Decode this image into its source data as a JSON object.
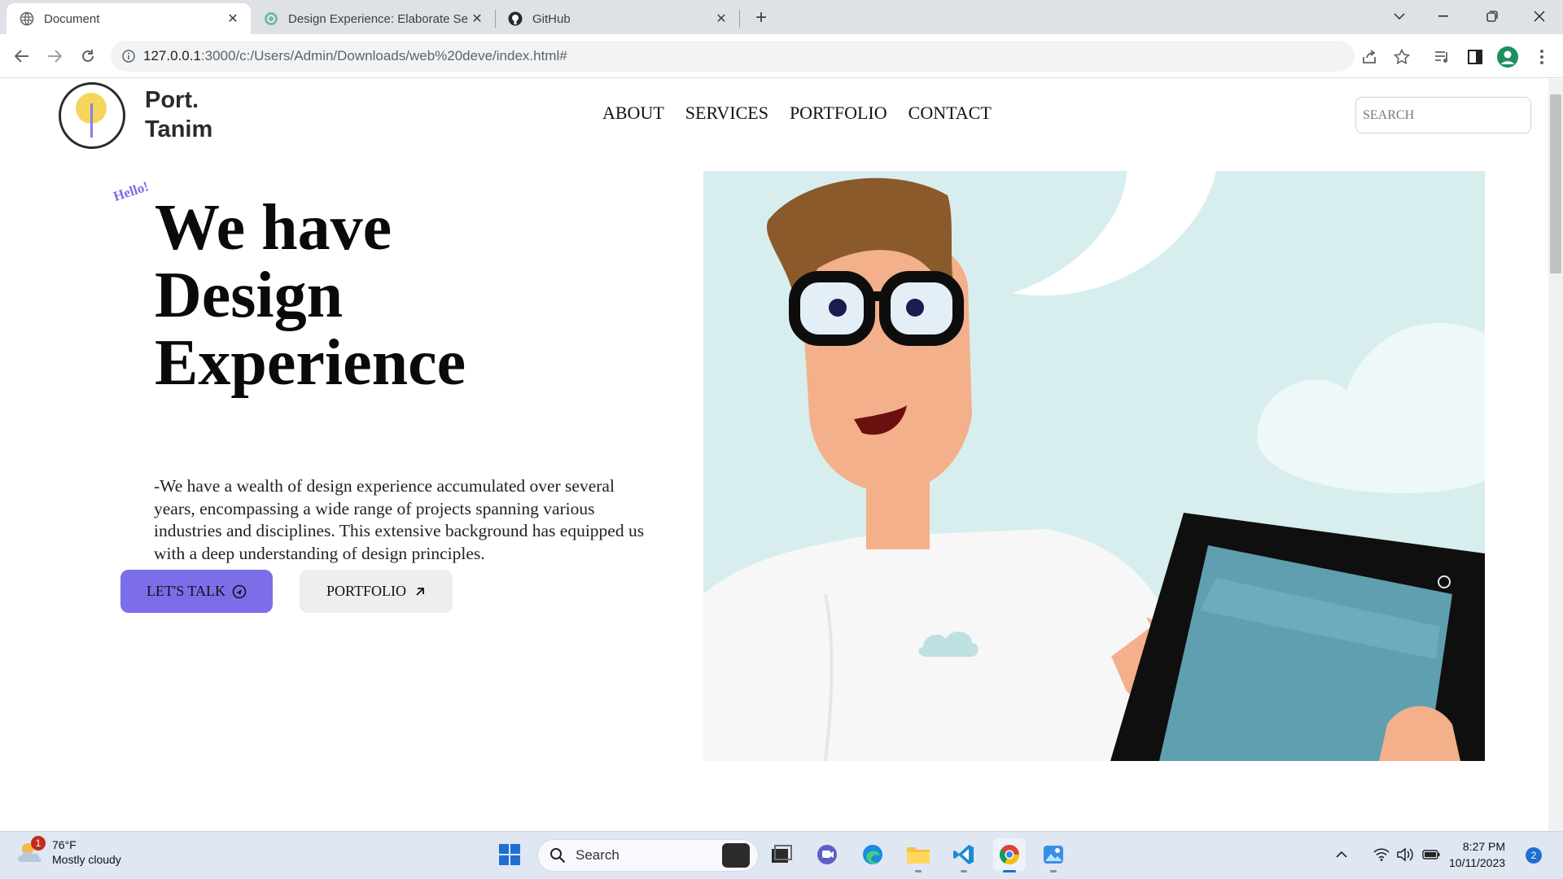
{
  "browser": {
    "tabs": [
      {
        "title": "Document",
        "icon": "globe-icon",
        "active": true
      },
      {
        "title": "Design Experience: Elaborate Se",
        "icon": "chatgpt-icon",
        "active": false
      },
      {
        "title": "GitHub",
        "icon": "github-icon",
        "active": false
      }
    ],
    "url_host": "127.0.0.1",
    "url_path": ":3000/c:/Users/Admin/Downloads/web%20deve/index.html#"
  },
  "site": {
    "logo": {
      "line1": "Port.",
      "line2": "Tanim"
    },
    "nav": [
      "ABOUT",
      "SERVICES",
      "PORTFOLIO",
      "CONTACT"
    ],
    "search_placeholder": "SEARCH",
    "hero": {
      "greeting": "Hello!",
      "headline_lines": [
        "We have",
        "Design",
        "Experience"
      ],
      "description": "-We have a wealth of design experience accumulated over several years, encompassing a wide range of projects spanning various industries and disciplines. This extensive background has equipped us with a deep understanding of design principles.",
      "cta_primary": "LET'S TALK",
      "cta_secondary": "PORTFOLIO"
    },
    "colors": {
      "accent": "#7b6ee8",
      "sun": "#f6d55c"
    }
  },
  "taskbar": {
    "weather_temp": "76°F",
    "weather_desc": "Mostly cloudy",
    "weather_badge": "1",
    "search_label": "Search",
    "time": "8:27 PM",
    "date": "10/11/2023",
    "notification_count": "2"
  }
}
